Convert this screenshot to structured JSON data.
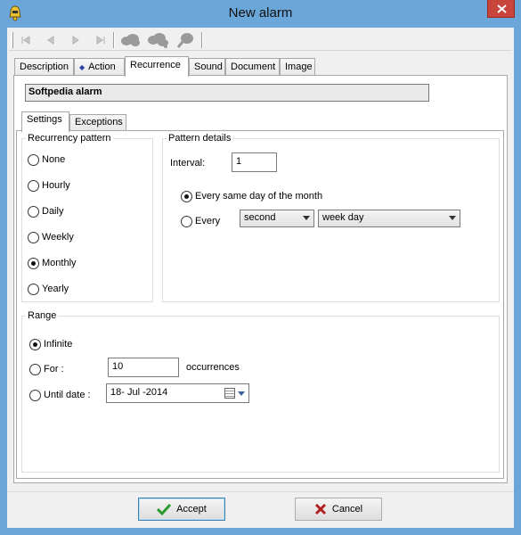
{
  "window": {
    "title": "New alarm",
    "icon": "alarm-bell-icon"
  },
  "toolbar": {
    "buttons": [
      {
        "icon": "first-record-icon"
      },
      {
        "icon": "previous-record-icon"
      },
      {
        "icon": "next-record-icon"
      },
      {
        "icon": "last-record-icon"
      },
      {
        "icon": "cloud-icon"
      },
      {
        "icon": "cloud-multiple-icon"
      },
      {
        "icon": "search-cloud-icon"
      }
    ]
  },
  "tabs": [
    {
      "label": "Description"
    },
    {
      "label": "Action",
      "icon": "diamond-icon"
    },
    {
      "label": "Recurrence",
      "active": true
    },
    {
      "label": "Sound"
    },
    {
      "label": "Document"
    },
    {
      "label": "Image"
    }
  ],
  "alarm_name": "Softpedia alarm",
  "subtabs": [
    {
      "label": "Settings",
      "active": true
    },
    {
      "label": "Exceptions"
    }
  ],
  "recurrency": {
    "legend": "Recurrency pattern",
    "options": [
      {
        "label": "None",
        "checked": false
      },
      {
        "label": "Hourly",
        "checked": false
      },
      {
        "label": "Daily",
        "checked": false
      },
      {
        "label": "Weekly",
        "checked": false
      },
      {
        "label": "Monthly",
        "checked": true
      },
      {
        "label": "Yearly",
        "checked": false
      }
    ]
  },
  "pattern": {
    "legend": "Pattern details",
    "interval_label": "Interval:",
    "interval_value": "1",
    "same_day_label": "Every same day of the month",
    "same_day_checked": true,
    "every_label": "Every",
    "every_checked": false,
    "ordinal_value": "second",
    "day_value": "week day"
  },
  "range": {
    "legend": "Range",
    "infinite_label": "Infinite",
    "infinite_checked": true,
    "for_label": "For :",
    "for_checked": false,
    "for_value": "10",
    "occurrences_label": "occurrences",
    "until_label": "Until date :",
    "until_checked": false,
    "until_value": "18- Jul -2014"
  },
  "buttons": {
    "accept": "Accept",
    "cancel": "Cancel"
  },
  "colors": {
    "titlebar": "#6ba6d9",
    "close": "#c7453b",
    "accept_check": "#2e9b2e",
    "cancel_x": "#b02020"
  }
}
